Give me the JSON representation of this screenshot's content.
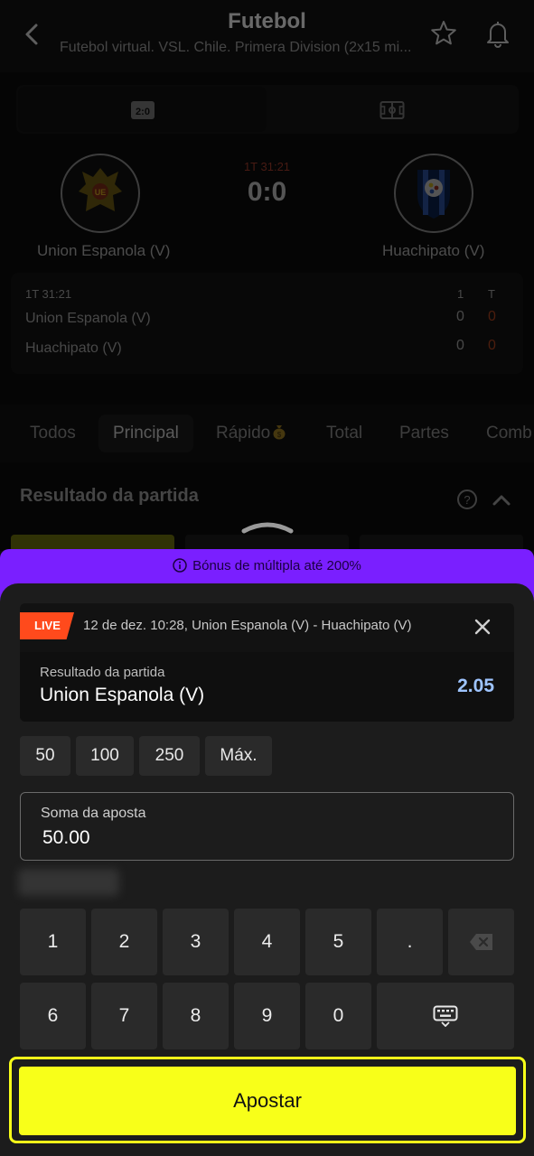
{
  "header": {
    "title": "Futebol",
    "subtitle": "Futebol virtual. VSL. Chile. Primera Division (2x15 mi..."
  },
  "view_toggle": {
    "scoreboard_icon_text": "2:0"
  },
  "match": {
    "live_time": "1T 31:21",
    "score": "0:0",
    "home_team": "Union Espanola (V)",
    "away_team": "Huachipato (V)",
    "home_logo_text": "UE"
  },
  "score_table": {
    "period": "1T 31:21",
    "col_1": "1",
    "col_t": "T",
    "rows": [
      {
        "team": "Union Espanola (V)",
        "p1": "0",
        "total": "0"
      },
      {
        "team": "Huachipato (V)",
        "p1": "0",
        "total": "0"
      }
    ]
  },
  "tabs": [
    "Todos",
    "Principal",
    "Rápido",
    "Total",
    "Partes",
    "Comb"
  ],
  "market": {
    "title": "Resultado da partida"
  },
  "bonus": {
    "text": "Bónus de múltipla até 200%"
  },
  "bet": {
    "live_label": "LIVE",
    "event": "12 de dez. 10:28, Union Espanola (V) - Huachipato (V)",
    "market": "Resultado da partida",
    "pick": "Union Espanola (V)",
    "odds": "2.05"
  },
  "quick_amounts": [
    "50",
    "100",
    "250",
    "Máx."
  ],
  "stake": {
    "label": "Soma da aposta",
    "value": "50.00"
  },
  "keypad": {
    "row1": [
      "1",
      "2",
      "3",
      "4",
      "5",
      "."
    ],
    "row2": [
      "6",
      "7",
      "8",
      "9",
      "0"
    ]
  },
  "submit": {
    "label": "Apostar"
  },
  "colors": {
    "accent_yellow": "#f8ff19",
    "bonus_purple": "#7a1fff",
    "live_orange": "#ff4a1c",
    "odds_blue": "#9ec4ff"
  }
}
